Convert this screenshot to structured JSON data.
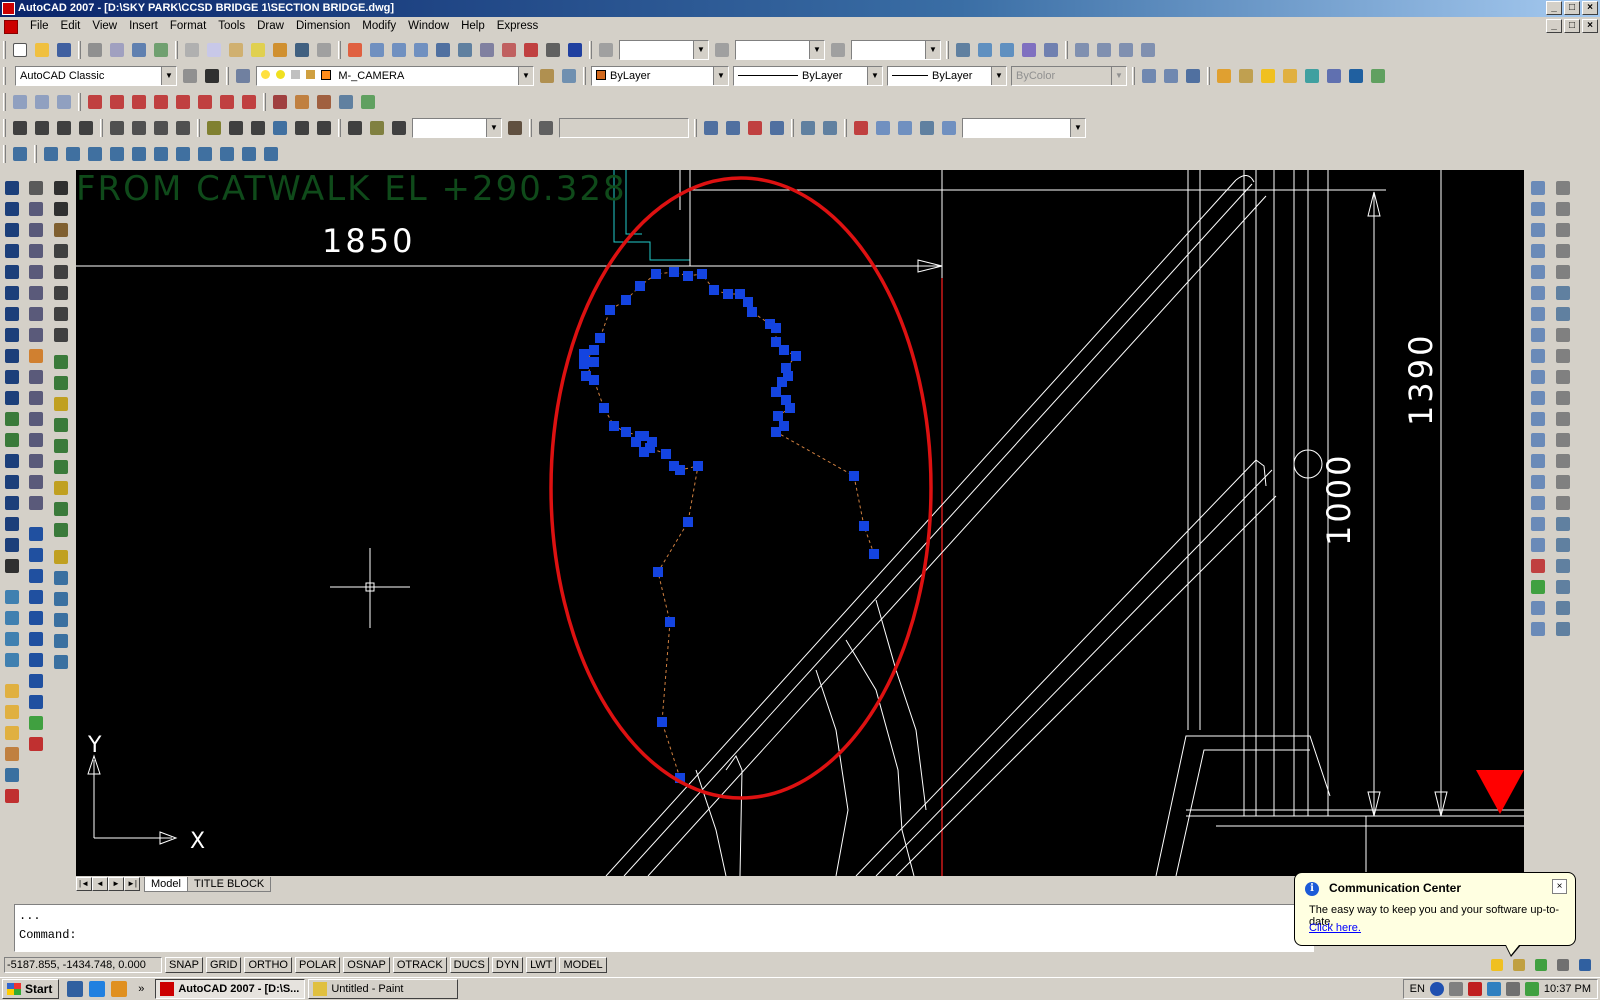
{
  "window": {
    "title": "AutoCAD 2007 - [D:\\SKY PARK\\CCSD BRIDGE 1\\SECTION BRIDGE.dwg]",
    "buttons": [
      "_",
      "□",
      "×"
    ],
    "mdi_buttons": [
      "_",
      "□",
      "×"
    ]
  },
  "menu": [
    "File",
    "Edit",
    "View",
    "Insert",
    "Format",
    "Tools",
    "Draw",
    "Dimension",
    "Modify",
    "Window",
    "Help",
    "Express"
  ],
  "toolbars": {
    "workspace": "AutoCAD Classic",
    "layer": "M-_CAMERA",
    "color": "ByLayer",
    "linetype": "ByLayer",
    "lineweight": "ByLayer",
    "plotstyle": "ByColor",
    "colors": {
      "layer_color": "#ff8c1a",
      "color_swatch": "#d2691e"
    }
  },
  "drawing": {
    "background": "#000000",
    "texts": {
      "catwalk": "FROM CATWALK EL +290.328",
      "dim_1850": "1850",
      "dim_1390": "1390",
      "dim_1000": "1000",
      "axis_y": "Y",
      "axis_x": "X"
    },
    "colors": {
      "ellipse": "#dd1111",
      "grips": "#1444e0",
      "lines": "#ffffff",
      "catwalk_text": "#0f4a1a"
    }
  },
  "layout_tabs": {
    "nav": [
      "|◄",
      "◄",
      "►",
      "►|"
    ],
    "tabs": [
      "Model",
      "TITLE BLOCK"
    ]
  },
  "command": {
    "history": "...",
    "prompt": "Command:"
  },
  "status": {
    "coords": "-5187.855, -1434.748, 0.000",
    "toggles": [
      "SNAP",
      "GRID",
      "ORTHO",
      "POLAR",
      "OSNAP",
      "OTRACK",
      "DUCS",
      "DYN",
      "LWT",
      "MODEL"
    ]
  },
  "balloon": {
    "title": "Communication Center",
    "text": "The easy way to keep you and your software up-to-date.",
    "link": "Click here.",
    "close": "×"
  },
  "taskbar": {
    "start": "Start",
    "tasks": [
      "AutoCAD 2007 - [D:\\S...",
      "Untitled - Paint"
    ],
    "lang": "EN",
    "time": "10:37 PM"
  }
}
